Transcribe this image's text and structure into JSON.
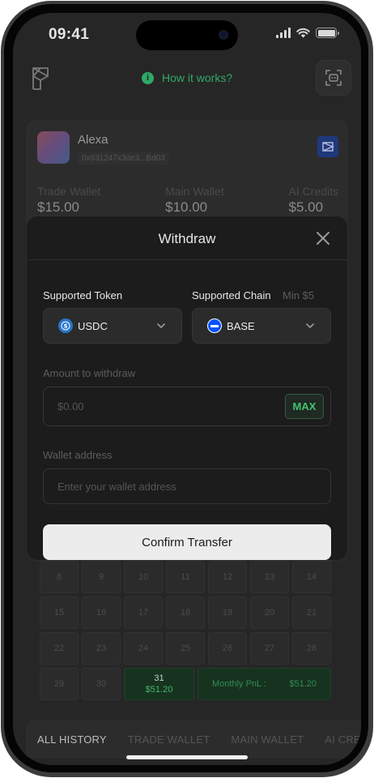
{
  "status_bar": {
    "time": "09:41"
  },
  "header": {
    "how_it_works": "How it works?"
  },
  "account": {
    "name": "Alexa",
    "address": "0x931247x3de3...Bd03",
    "wallets": [
      {
        "label": "Trade Wallet",
        "value": "$15.00"
      },
      {
        "label": "Main Wallet",
        "value": "$10.00"
      },
      {
        "label": "AI Credits",
        "value": "$5.00"
      }
    ]
  },
  "calendar": {
    "rows": [
      [
        "8",
        "9",
        "10",
        "11",
        "12",
        "13",
        "14"
      ],
      [
        "15",
        "16",
        "17",
        "18",
        "19",
        "20",
        "21"
      ],
      [
        "22",
        "23",
        "24",
        "25",
        "26",
        "27",
        "28"
      ]
    ],
    "last_row": {
      "days": [
        "29",
        "30"
      ],
      "highlight_day": "31",
      "highlight_amount": "$51.20",
      "pnl_label": "Monthly PnL :",
      "pnl_value": "$51.20"
    }
  },
  "history_tabs": [
    "ALL HISTORY",
    "TRADE WALLET",
    "MAIN WALLET",
    "AI CRE"
  ],
  "modal": {
    "title": "Withdraw",
    "token_label": "Supported Token",
    "chain_label": "Supported Chain",
    "min_label": "Min $5",
    "token_value": "USDC",
    "chain_value": "BASE",
    "amount_label": "Amount to withdraw",
    "amount_placeholder": "$0.00",
    "max_label": "MAX",
    "wallet_label": "Wallet address",
    "wallet_placeholder": "Enter your wallet address",
    "confirm_label": "Confirm Transfer"
  },
  "colors": {
    "accent_green": "#2fa968",
    "background": "#262626",
    "modal_background": "#1c1c1c",
    "usdc_blue": "#2775ca",
    "base_blue": "#0052ff"
  }
}
